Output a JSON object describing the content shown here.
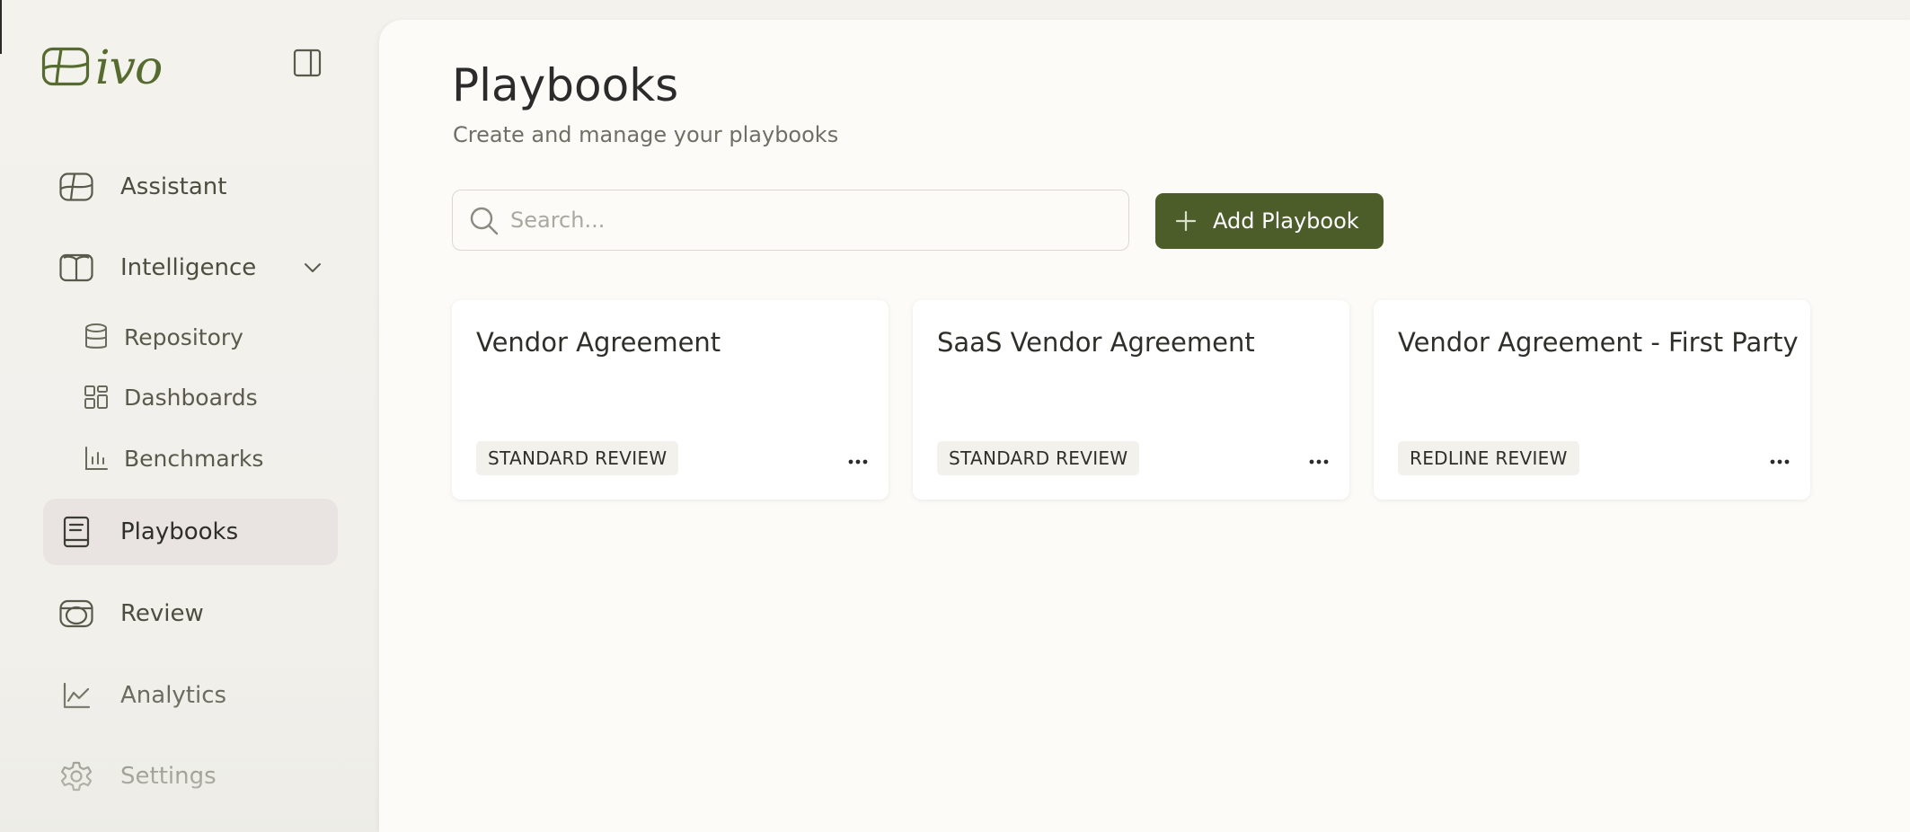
{
  "sidebar": {
    "logo": {
      "word": "ivo",
      "icon": "ivo-logo-icon"
    },
    "panel_toggle_icon": "panel-toggle-icon",
    "items": [
      {
        "label": "Assistant",
        "icon": "assistant-icon"
      },
      {
        "label": "Intelligence",
        "icon": "book-open-icon",
        "expanded": true,
        "children": [
          {
            "label": "Repository",
            "icon": "database-icon"
          },
          {
            "label": "Dashboards",
            "icon": "dashboard-grid-icon"
          },
          {
            "label": "Benchmarks",
            "icon": "bar-chart-icon"
          }
        ]
      },
      {
        "label": "Playbooks",
        "icon": "notebook-icon",
        "active": true
      },
      {
        "label": "Review",
        "icon": "review-icon"
      },
      {
        "label": "Analytics",
        "icon": "line-chart-icon"
      },
      {
        "label": "Settings",
        "icon": "gear-icon"
      }
    ]
  },
  "main": {
    "title": "Playbooks",
    "subtitle": "Create and manage your playbooks",
    "search": {
      "placeholder": "Search...",
      "value": ""
    },
    "add_button_label": "Add Playbook",
    "cards": [
      {
        "title": "Vendor Agreement",
        "badge": "STANDARD REVIEW"
      },
      {
        "title": "SaaS Vendor Agreement",
        "badge": "STANDARD REVIEW"
      },
      {
        "title": "Vendor Agreement - First Party",
        "badge": "REDLINE REVIEW"
      }
    ]
  },
  "colors": {
    "brand": "#556b2f",
    "button": "#4c5d2a",
    "active_nav": "#e9e4e1",
    "background": "#fcfbf8"
  }
}
